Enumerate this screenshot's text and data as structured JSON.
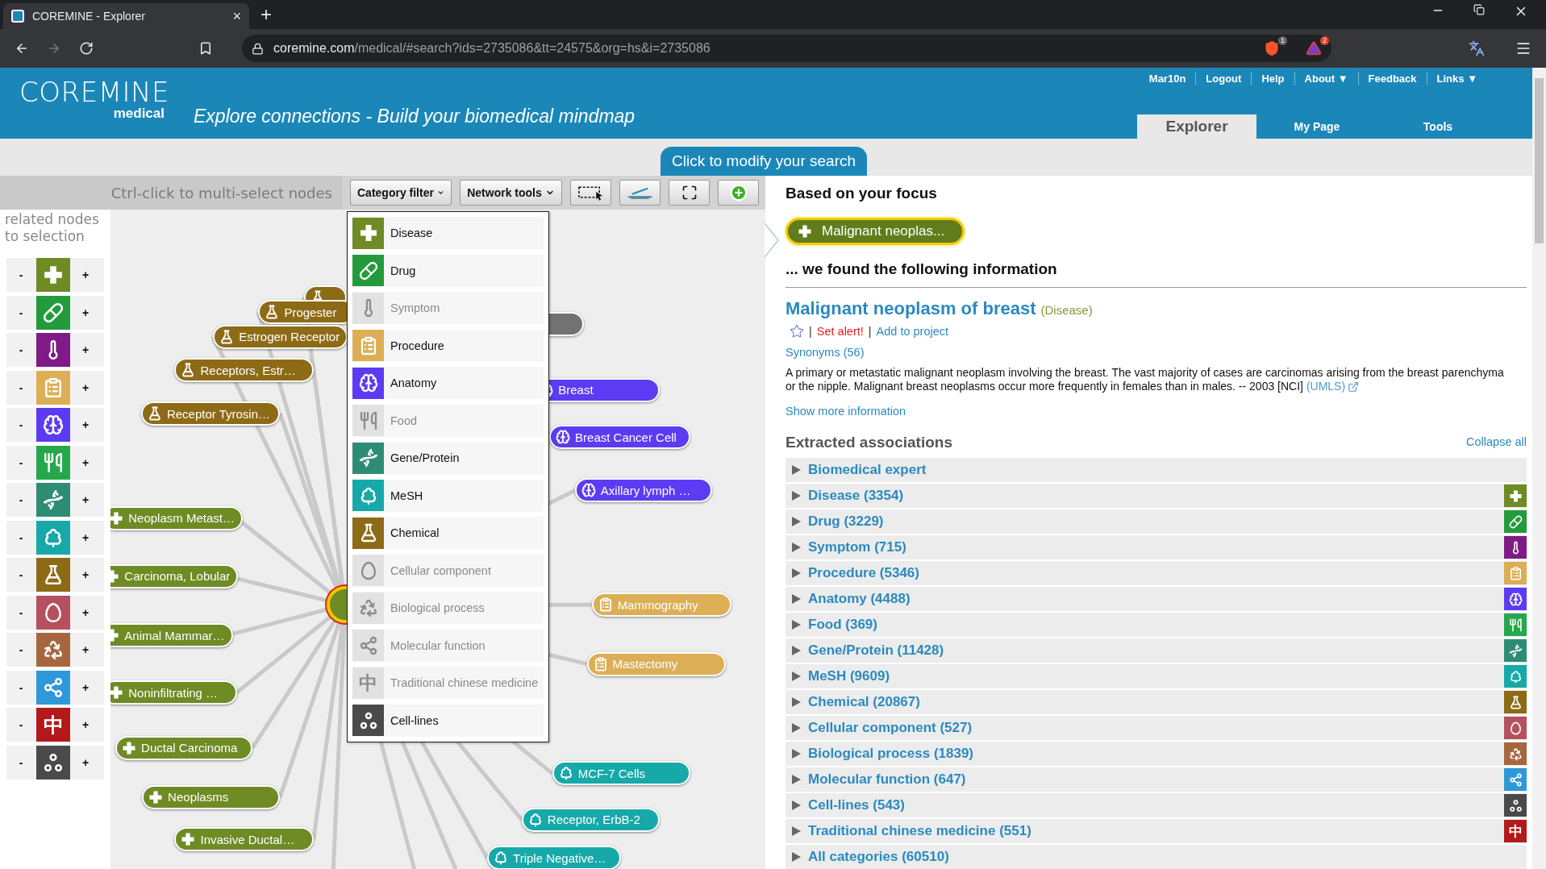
{
  "browser": {
    "tab_title": "COREMINE - Explorer",
    "tab_close": "×",
    "new_tab": "+",
    "url_host": "coremine.com",
    "url_path": "/medical/#search?ids=2735086&tt=24575&org=hs&i=2735086",
    "shield_badge": "1",
    "alert_badge": "2"
  },
  "header": {
    "logo": "COREMINE",
    "logo_sub": "medical",
    "tagline": "Explore connections - Build your biomedical mindmap",
    "links": [
      "Mar10n",
      "Logout",
      "Help",
      "About ▼",
      "Feedback",
      "Links ▼"
    ],
    "tabs": [
      {
        "label": "Explorer",
        "selected": true
      },
      {
        "label": "My Page",
        "selected": false
      },
      {
        "label": "Tools",
        "selected": false
      }
    ]
  },
  "search_tab": "Click to modify your search",
  "toolbar": {
    "hint": "Ctrl-click to multi-select nodes",
    "menus": [
      "Category filter",
      "Network tools"
    ],
    "tools": [
      {
        "kind": "select"
      },
      {
        "kind": "edge"
      },
      {
        "kind": "fit"
      },
      {
        "kind": "add"
      }
    ]
  },
  "palette": {
    "title": "related nodes to selection",
    "items": [
      {
        "kind": "disease",
        "color": "#6e8b24",
        "minus": "-",
        "plus": "+"
      },
      {
        "kind": "drug",
        "color": "#239b3c",
        "minus": "-",
        "plus": "+"
      },
      {
        "kind": "symptom",
        "color": "#7f1a86",
        "minus": "-",
        "plus": "+"
      },
      {
        "kind": "procedure",
        "color": "#dcae55",
        "minus": "-",
        "plus": "+"
      },
      {
        "kind": "anatomy",
        "color": "#5b3cf2",
        "minus": "-",
        "plus": "+"
      },
      {
        "kind": "food",
        "color": "#25a84c",
        "minus": "-",
        "plus": "+"
      },
      {
        "kind": "gene",
        "color": "#2e8c74",
        "minus": "-",
        "plus": "+"
      },
      {
        "kind": "mesh",
        "color": "#17a9a9",
        "minus": "-",
        "plus": "+"
      },
      {
        "kind": "chemical",
        "color": "#8d6a16",
        "minus": "-",
        "plus": "+"
      },
      {
        "kind": "cellular",
        "color": "#b5505f",
        "minus": "-",
        "plus": "+"
      },
      {
        "kind": "bioprocess",
        "color": "#a6673f",
        "minus": "-",
        "plus": "+"
      },
      {
        "kind": "molecular",
        "color": "#2f98d8",
        "minus": "-",
        "plus": "+"
      },
      {
        "kind": "tcm",
        "color": "#b3191b",
        "glyph": "中",
        "minus": "-",
        "plus": "+"
      },
      {
        "kind": "celllines",
        "color": "#4a4a4a",
        "minus": "-",
        "plus": "+"
      }
    ]
  },
  "category_menu": {
    "items": [
      {
        "label": "Disease",
        "kind": "disease",
        "enabled": true,
        "color": "#6e8b24"
      },
      {
        "label": "Drug",
        "kind": "drug",
        "enabled": true,
        "color": "#239b3c"
      },
      {
        "label": "Symptom",
        "kind": "symptom",
        "enabled": false
      },
      {
        "label": "Procedure",
        "kind": "procedure",
        "enabled": true,
        "color": "#dcae55"
      },
      {
        "label": "Anatomy",
        "kind": "anatomy",
        "enabled": true,
        "color": "#5b3cf2"
      },
      {
        "label": "Food",
        "kind": "food",
        "enabled": false
      },
      {
        "label": "Gene/Protein",
        "kind": "gene",
        "enabled": true,
        "color": "#2e8c74"
      },
      {
        "label": "MeSH",
        "kind": "mesh",
        "enabled": true,
        "color": "#17a9a9"
      },
      {
        "label": "Chemical",
        "kind": "chemical",
        "enabled": true,
        "color": "#8d6a16"
      },
      {
        "label": "Cellular component",
        "kind": "cellular",
        "enabled": false
      },
      {
        "label": "Biological process",
        "kind": "bioprocess",
        "enabled": false
      },
      {
        "label": "Molecular function",
        "kind": "molecular",
        "enabled": false
      },
      {
        "label": "Traditional chinese medicine",
        "kind": "tcm",
        "glyph": "中",
        "enabled": false
      },
      {
        "label": "Cell-lines",
        "kind": "celllines",
        "enabled": true,
        "color": "#4a4a4a"
      }
    ]
  },
  "network": {
    "nodes": [
      {
        "kind": "chemical",
        "color": "#8d6a16"
      },
      {
        "label": "Progester",
        "kind": "chemical",
        "color": "#8d6a16"
      },
      {
        "label": "Estrogen Receptor",
        "kind": "chemical",
        "color": "#8d6a16"
      },
      {
        "label": "Receptors, Estr…",
        "kind": "chemical",
        "color": "#8d6a16"
      },
      {
        "label": "Receptor Tyrosin…",
        "kind": "chemical",
        "color": "#8d6a16"
      },
      {
        "label": "Neoplasm Metast…",
        "kind": "disease",
        "color": "#6e8b24"
      },
      {
        "label": "Carcinoma, Lobular",
        "kind": "disease",
        "color": "#6e8b24"
      },
      {
        "label": "Animal Mammar…",
        "kind": "disease",
        "color": "#6e8b24"
      },
      {
        "label": "Noninfiltrating …",
        "kind": "disease",
        "color": "#6e8b24"
      },
      {
        "label": "Ductal Carcinoma",
        "kind": "disease",
        "color": "#6e8b24"
      },
      {
        "label": "Neoplasms",
        "kind": "disease",
        "color": "#6e8b24"
      },
      {
        "label": "Invasive Ductal…",
        "kind": "disease",
        "color": "#6e8b24"
      },
      {
        "kind": "other",
        "color": "#727272"
      },
      {
        "label": "Breast",
        "kind": "anatomy",
        "color": "#5b3cf2"
      },
      {
        "label": "Breast Cancer Cell",
        "kind": "anatomy",
        "color": "#5b3cf2"
      },
      {
        "label": "Axillary lymph …",
        "kind": "anatomy",
        "color": "#5b3cf2"
      },
      {
        "label": "Mammography",
        "kind": "procedure",
        "color": "#dcae55"
      },
      {
        "label": "Mastectomy",
        "kind": "procedure",
        "color": "#dcae55"
      },
      {
        "label": "MCF-7 Cells",
        "kind": "mesh",
        "color": "#17a9a9"
      },
      {
        "label": "Receptor, ErbB-2",
        "kind": "mesh",
        "color": "#17a9a9"
      },
      {
        "label": "Triple Negative…",
        "kind": "mesh",
        "color": "#17a9a9"
      }
    ]
  },
  "focus": {
    "heading": "Based on your focus",
    "node": {
      "label": "Malignant neoplas...",
      "kind": "disease",
      "color": "#5f7d1c"
    }
  },
  "info": {
    "heading": "... we found the following information",
    "title": "Malignant neoplasm of breast",
    "category": "(Disease)",
    "starred": false,
    "actions": [
      {
        "prefix": "|",
        "label": "Set alert!",
        "kind": "alert"
      },
      {
        "prefix": "|",
        "label": "Add to project",
        "kind": "link"
      }
    ],
    "synonyms": "Synonyms (56)",
    "description": "A primary or metastatic malignant neoplasm involving the breast. The vast majority of cases are carcinomas arising from the breast parenchyma or the nipple. Malignant breast neoplasms occur more frequently in females than in males. -- 2003 [NCI]",
    "source_link": "(UMLS)",
    "more": "Show more information"
  },
  "associations": {
    "heading": "Extracted associations",
    "collapse": "Collapse all",
    "rows": [
      {
        "label": "Biomedical expert",
        "kind": "expert",
        "expanded": false
      },
      {
        "label": "Disease (3354)",
        "kind": "disease",
        "color": "#6e8b24",
        "expanded": false
      },
      {
        "label": "Drug (3229)",
        "kind": "drug",
        "color": "#239b3c",
        "expanded": false
      },
      {
        "label": "Symptom (715)",
        "kind": "symptom",
        "color": "#7f1a86",
        "expanded": false
      },
      {
        "label": "Procedure (5346)",
        "kind": "procedure",
        "color": "#dcae55",
        "expanded": false
      },
      {
        "label": "Anatomy (4488)",
        "kind": "anatomy",
        "color": "#5b3cf2",
        "expanded": false
      },
      {
        "label": "Food (369)",
        "kind": "food",
        "color": "#25a84c",
        "expanded": false
      },
      {
        "label": "Gene/Protein (11428)",
        "kind": "gene",
        "color": "#2e8c74",
        "expanded": false
      },
      {
        "label": "MeSH (9609)",
        "kind": "mesh",
        "color": "#17a9a9",
        "expanded": false
      },
      {
        "label": "Chemical (20867)",
        "kind": "chemical",
        "color": "#8d6a16",
        "expanded": false
      },
      {
        "label": "Cellular component (527)",
        "kind": "cellular",
        "color": "#b5505f",
        "expanded": false
      },
      {
        "label": "Biological process (1839)",
        "kind": "bioprocess",
        "color": "#a6673f",
        "expanded": false
      },
      {
        "label": "Molecular function (647)",
        "kind": "molecular",
        "color": "#2f98d8",
        "expanded": false
      },
      {
        "label": "Cell-lines (543)",
        "kind": "celllines",
        "color": "#4a4a4a",
        "expanded": false
      },
      {
        "label": "Traditional chinese medicine (551)",
        "kind": "tcm",
        "glyph": "中",
        "color": "#b3191b",
        "expanded": false
      },
      {
        "label": "All categories (60510)",
        "kind": "all",
        "expanded": false
      }
    ]
  }
}
